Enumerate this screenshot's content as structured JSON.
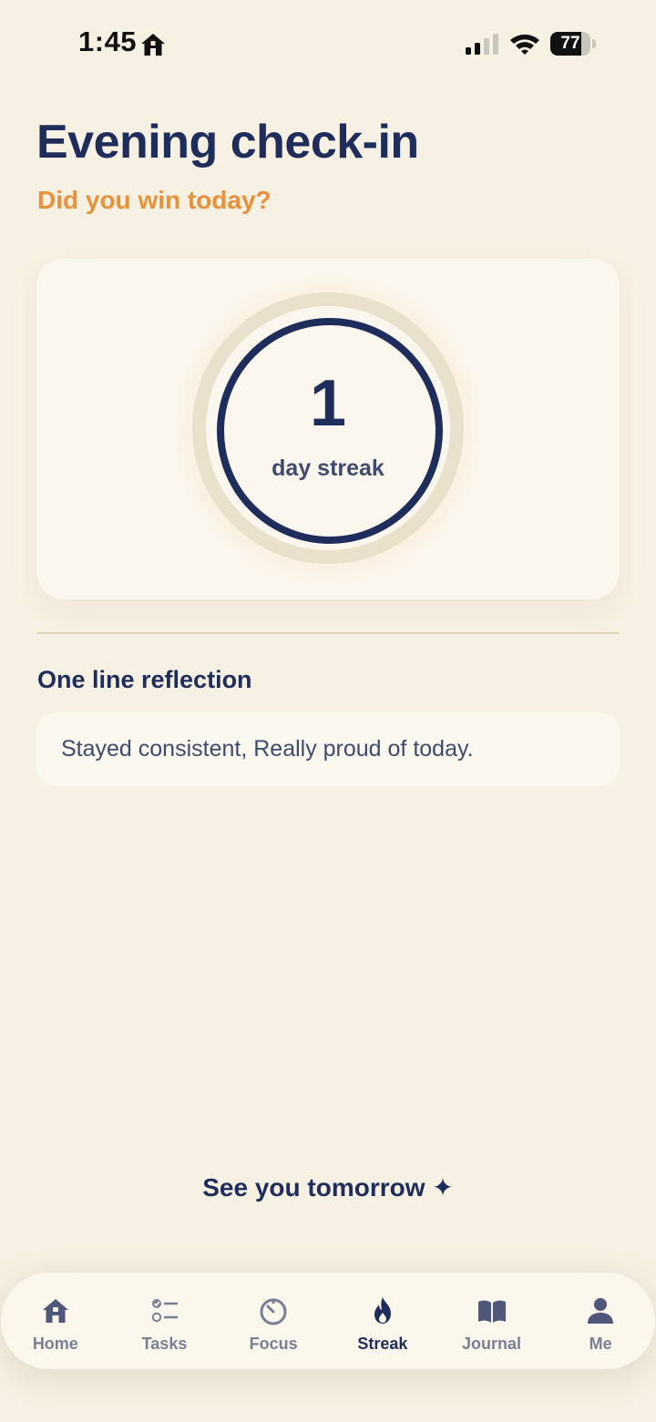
{
  "status_bar": {
    "time": "1:45",
    "battery_level": "77",
    "battery_fraction": 0.77
  },
  "header": {
    "title": "Evening check-in",
    "subtitle": "Did you win today?"
  },
  "streak": {
    "count": "1",
    "label": "day streak"
  },
  "reflection": {
    "heading": "One line reflection",
    "value": "Stayed consistent, Really proud of today."
  },
  "footer": {
    "message": "See you tomorrow ✦"
  },
  "colors": {
    "background": "#f7f1e3",
    "primary": "#1f2d5c",
    "accent": "#e8903a",
    "inactive": "#7a7f95"
  },
  "tab_bar": {
    "active": "Streak",
    "items": [
      {
        "label": "Home",
        "icon": "home-icon"
      },
      {
        "label": "Tasks",
        "icon": "tasks-icon"
      },
      {
        "label": "Focus",
        "icon": "timer-icon"
      },
      {
        "label": "Streak",
        "icon": "flame-icon"
      },
      {
        "label": "Journal",
        "icon": "book-icon"
      },
      {
        "label": "Me",
        "icon": "person-icon"
      }
    ]
  }
}
